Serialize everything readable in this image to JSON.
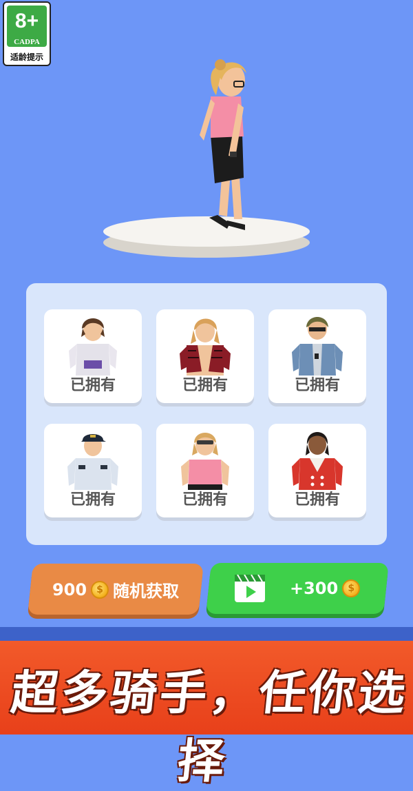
{
  "age_rating": {
    "number": "8+",
    "org": "CADPA",
    "label": "适龄提示"
  },
  "stage": {
    "character_name": "rider-pink-shirt"
  },
  "characters": [
    {
      "status": "已拥有",
      "outfit": "white-shirt-purple-belt"
    },
    {
      "status": "已拥有",
      "outfit": "red-plaid-shirt"
    },
    {
      "status": "已拥有",
      "outfit": "denim-jacket"
    },
    {
      "status": "已拥有",
      "outfit": "police-uniform"
    },
    {
      "status": "已拥有",
      "outfit": "pink-shirt"
    },
    {
      "status": "已拥有",
      "outfit": "red-coat"
    }
  ],
  "buttons": {
    "random": {
      "cost": "900",
      "label": "随机获取"
    },
    "video": {
      "reward": "+300"
    }
  },
  "banner": {
    "text": "超多骑手，任你选择"
  },
  "colors": {
    "background": "#6d96f7",
    "panel": "#d9e6fb",
    "orange_button": "#e98a45",
    "green_button": "#3ed04a",
    "banner": "#e8401a"
  }
}
